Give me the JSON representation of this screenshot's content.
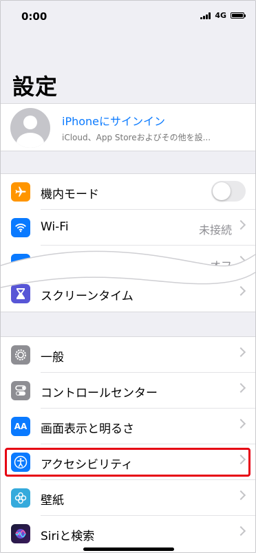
{
  "status_bar": {
    "time": "0:00",
    "network": "4G"
  },
  "title": "設定",
  "profile": {
    "name": "iPhoneにサインイン",
    "subtitle": "iCloud、App Storeおよびその他を設..."
  },
  "colors": {
    "accent": "#0a7aff",
    "highlight": "#e60012",
    "airplane": "#ff9500",
    "wifi": "#0a7aff",
    "screen_time": "#5856d6",
    "general": "#8e8e93",
    "display": "#0a7aff",
    "accessibility": "#0a7aff",
    "wallpaper": "#35aadc"
  },
  "group1": {
    "airplane": {
      "label": "機内モード",
      "icon": "airplane-icon",
      "toggle_on": false
    },
    "wifi": {
      "label": "Wi-Fi",
      "value": "未接続",
      "icon": "wifi-icon"
    },
    "bluetooth": {
      "value": "オフ",
      "icon": "bluetooth-icon"
    },
    "screen_time": {
      "label": "スクリーンタイム",
      "icon": "hourglass-icon"
    }
  },
  "group2": {
    "general": {
      "label": "一般",
      "icon": "gear-icon"
    },
    "control_center": {
      "label": "コントロールセンター",
      "icon": "switches-icon"
    },
    "display": {
      "label": "画面表示と明るさ",
      "icon": "text-size-icon",
      "icon_text": "AA"
    },
    "accessibility": {
      "label": "アクセシビリティ",
      "icon": "accessibility-icon"
    },
    "wallpaper": {
      "label": "壁紙",
      "icon": "flower-icon"
    },
    "siri": {
      "label": "Siriと検索",
      "icon": "siri-icon"
    }
  }
}
